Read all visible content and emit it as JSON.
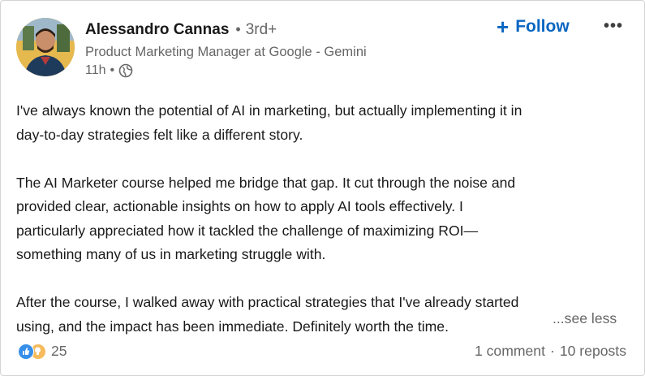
{
  "author": {
    "name": "Alessandro Cannas",
    "degree": "3rd+",
    "headline": "Product Marketing Manager at Google - Gemini",
    "time": "11h",
    "visibility_icon": "globe-icon"
  },
  "actions": {
    "follow_label": "Follow",
    "follow_icon": "plus-icon",
    "more_icon": "more-options-icon",
    "accent_color": "#0a66c2"
  },
  "post": {
    "paragraphs": [
      {
        "lines": [
          "I've always known the potential of AI in marketing, but actually implementing it in",
          "day-to-day strategies felt like a different story."
        ]
      },
      {
        "lines": [
          "The AI Marketer course helped me bridge that gap. It cut through the noise and",
          "provided clear, actionable insights on how to apply AI tools effectively. I",
          "particularly appreciated how it tackled the challenge of maximizing ROI—",
          "something many of us in marketing struggle with."
        ]
      },
      {
        "lines": [
          "After the course, I walked away with practical strategies that I've already started",
          "using, and the impact has been immediate. Definitely worth the time."
        ]
      }
    ],
    "see_less": "...see less"
  },
  "social": {
    "reaction_icons": [
      "like-icon",
      "insightful-icon"
    ],
    "reaction_count": "25",
    "comments": "1 comment",
    "reposts": "10 reposts"
  }
}
